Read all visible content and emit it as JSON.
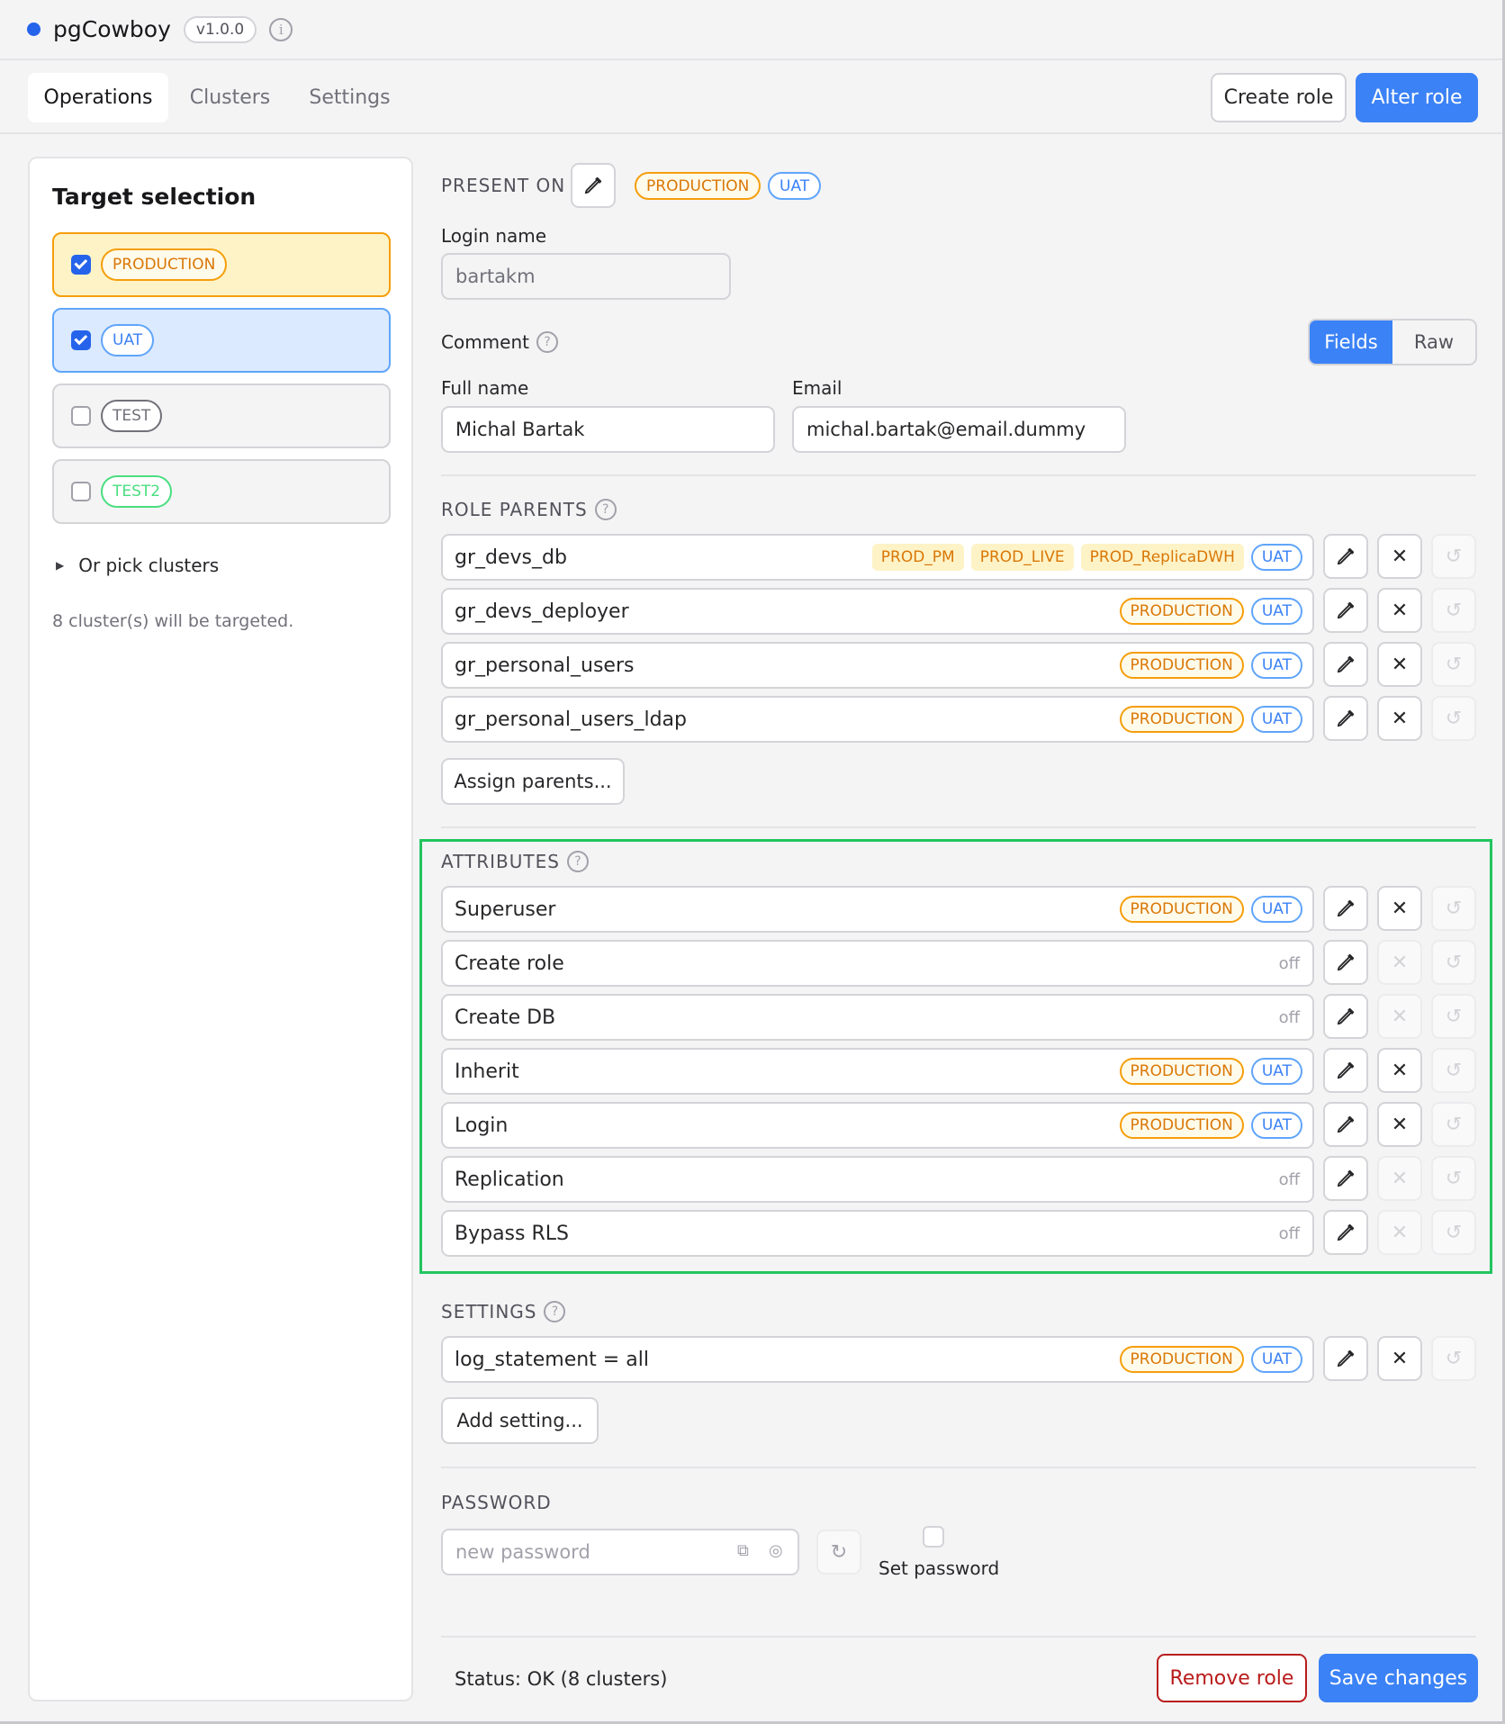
{
  "app": {
    "title": "pgCowboy",
    "version": "v1.0.0",
    "info_icon": "info-icon",
    "accent": "#2563eb"
  },
  "nav": {
    "tabs": [
      {
        "label": "Operations",
        "active": true
      },
      {
        "label": "Clusters",
        "active": false
      },
      {
        "label": "Settings",
        "active": false
      }
    ],
    "create_role_label": "Create role",
    "alter_role_label": "Alter role"
  },
  "target_selection": {
    "title": "Target selection",
    "targets": [
      {
        "label": "PRODUCTION",
        "checked": true
      },
      {
        "label": "UAT",
        "checked": true
      },
      {
        "label": "TEST",
        "checked": false
      },
      {
        "label": "TEST2",
        "checked": false
      }
    ],
    "pick_clusters": "Or pick clusters",
    "targeted_text": "8 cluster(s) will be targeted."
  },
  "present_on": {
    "label": "PRESENT ON",
    "badges": [
      "PRODUCTION",
      "UAT"
    ]
  },
  "login": {
    "label": "Login name",
    "value": "bartakm"
  },
  "comment": {
    "label": "Comment",
    "mode_fields": "Fields",
    "mode_raw": "Raw",
    "full_name_label": "Full name",
    "full_name_value": "Michal Bartak",
    "email_label": "Email",
    "email_value": "michal.bartak@email.dummy"
  },
  "role_parents": {
    "label": "ROLE PARENTS",
    "items": [
      {
        "name": "gr_devs_db",
        "soft_badges": [
          "PROD_PM",
          "PROD_LIVE",
          "PROD_ReplicaDWH"
        ],
        "badges": [
          "UAT"
        ]
      },
      {
        "name": "gr_devs_deployer",
        "soft_badges": [],
        "badges": [
          "PRODUCTION",
          "UAT"
        ]
      },
      {
        "name": "gr_personal_users",
        "soft_badges": [],
        "badges": [
          "PRODUCTION",
          "UAT"
        ]
      },
      {
        "name": "gr_personal_users_ldap",
        "soft_badges": [],
        "badges": [
          "PRODUCTION",
          "UAT"
        ]
      }
    ],
    "assign_label": "Assign parents..."
  },
  "attributes": {
    "label": "ATTRIBUTES",
    "off_text": "off",
    "items": [
      {
        "name": "Superuser",
        "badges": [
          "PRODUCTION",
          "UAT"
        ],
        "off": false
      },
      {
        "name": "Create role",
        "badges": [],
        "off": true
      },
      {
        "name": "Create DB",
        "badges": [],
        "off": true
      },
      {
        "name": "Inherit",
        "badges": [
          "PRODUCTION",
          "UAT"
        ],
        "off": false
      },
      {
        "name": "Login",
        "badges": [
          "PRODUCTION",
          "UAT"
        ],
        "off": false
      },
      {
        "name": "Replication",
        "badges": [],
        "off": true
      },
      {
        "name": "Bypass RLS",
        "badges": [],
        "off": true
      }
    ]
  },
  "settings": {
    "label": "SETTINGS",
    "items": [
      {
        "name": "log_statement = all",
        "badges": [
          "PRODUCTION",
          "UAT"
        ]
      }
    ],
    "add_label": "Add setting..."
  },
  "password": {
    "label": "PASSWORD",
    "placeholder": "new password",
    "set_password_label": "Set password",
    "set_password_checked": false
  },
  "footer": {
    "status": "Status: OK (8 clusters)",
    "remove_label": "Remove role",
    "save_label": "Save changes"
  },
  "colors": {
    "production": "#f59e0b",
    "uat": "#60a5fa",
    "highlight": "#22c55e",
    "danger": "#b91c1c"
  }
}
